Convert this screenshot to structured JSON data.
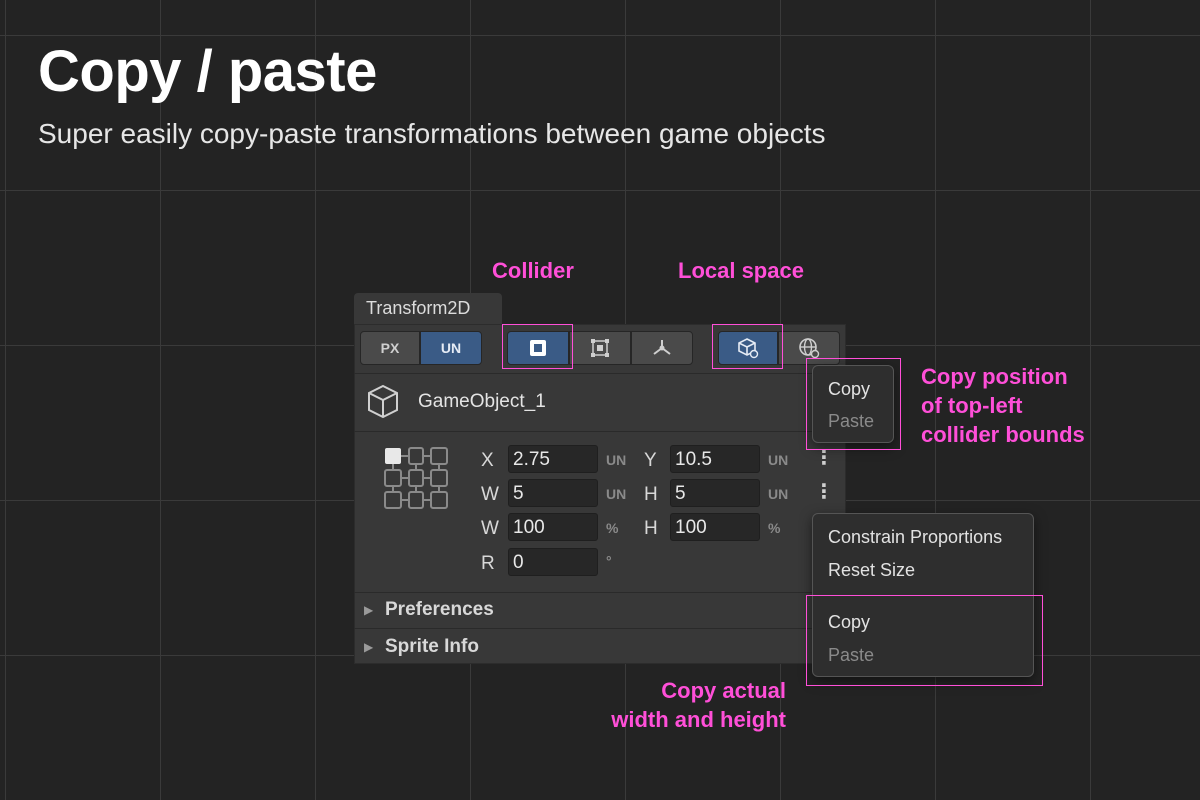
{
  "title": "Copy / paste",
  "subtitle": "Super easily copy-paste transformations between game objects",
  "annotations": {
    "collider": "Collider",
    "local_space": "Local space",
    "copy_position": [
      "Copy position",
      "of top-left",
      "collider bounds"
    ],
    "copy_size": [
      "Copy actual",
      "width and height"
    ]
  },
  "panel": {
    "tab": "Transform2D",
    "unit_toggle": {
      "px": "PX",
      "un": "UN",
      "selected": "UN"
    },
    "object_name": "GameObject_1",
    "rows": {
      "x": {
        "label": "X",
        "value": "2.75",
        "unit": "UN"
      },
      "y": {
        "label": "Y",
        "value": "10.5",
        "unit": "UN"
      },
      "w": {
        "label": "W",
        "value": "5",
        "unit": "UN"
      },
      "h": {
        "label": "H",
        "value": "5",
        "unit": "UN"
      },
      "wp": {
        "label": "W",
        "value": "100",
        "unit": "%"
      },
      "hp": {
        "label": "H",
        "value": "100",
        "unit": "%"
      },
      "r": {
        "label": "R",
        "value": "0",
        "unit": "°"
      }
    },
    "foldouts": [
      "Preferences",
      "Sprite Info"
    ]
  },
  "menu_position": {
    "copy": "Copy",
    "paste": "Paste"
  },
  "menu_size": {
    "constrain": "Constrain Proportions",
    "reset": "Reset Size",
    "copy": "Copy",
    "paste": "Paste"
  },
  "colors": {
    "accent": "#ff4fd8",
    "selected": "#3a5b86",
    "panel": "#383838",
    "background": "#232323"
  }
}
